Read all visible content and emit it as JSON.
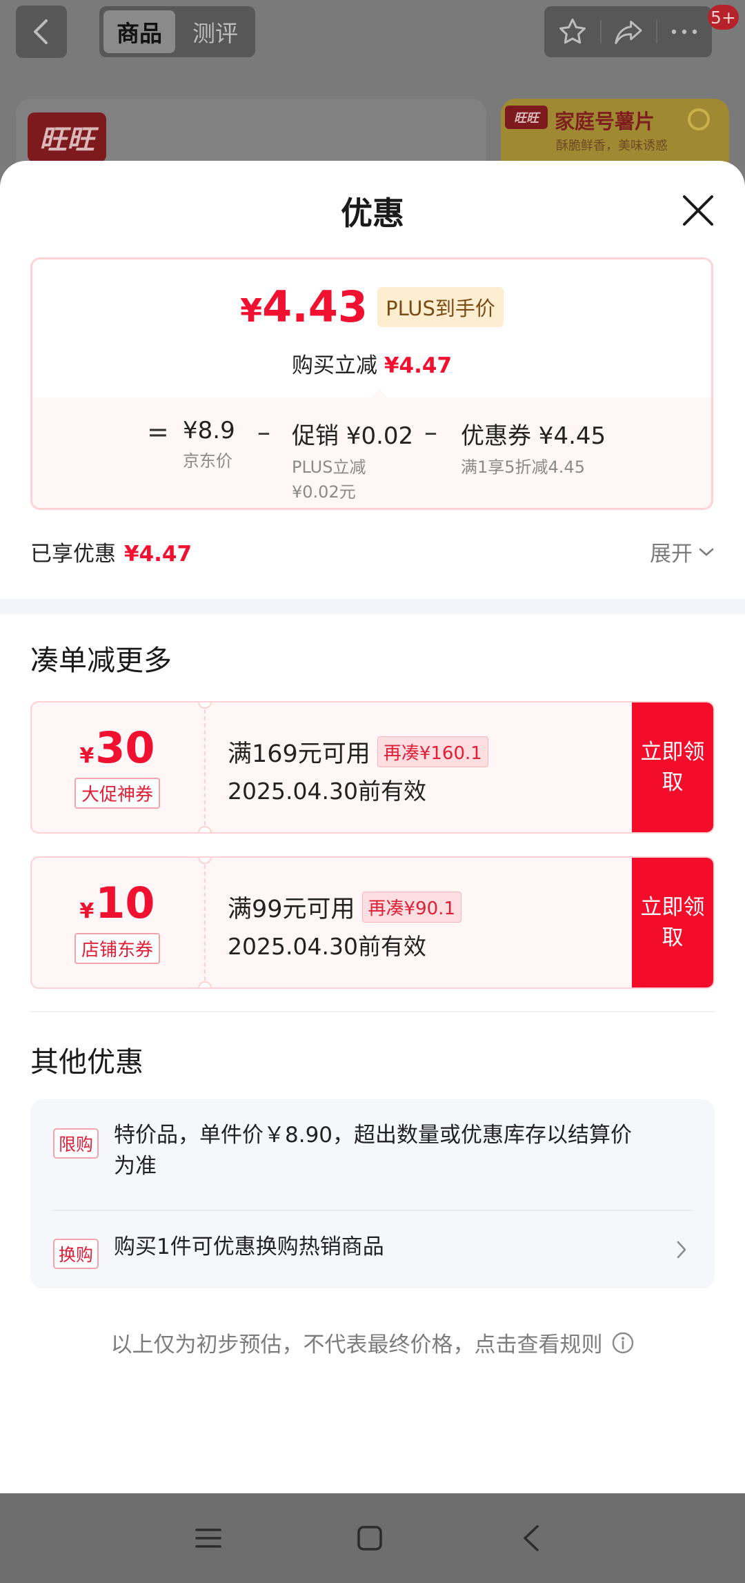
{
  "header": {
    "tabs": [
      {
        "label": "商品",
        "active": true
      },
      {
        "label": "测评",
        "active": false
      }
    ],
    "icons": [
      "back-icon",
      "star-icon",
      "share-icon",
      "more-icon"
    ],
    "message_badge": "5+"
  },
  "background": {
    "brand_logo": "旺旺",
    "ad_logo": "旺旺",
    "ad_title": "家庭号薯片",
    "ad_subtitle": "酥脆鲜香，美味诱惑"
  },
  "sheet": {
    "title": "优惠",
    "price": {
      "final_yen": "¥",
      "final_value": "4.43",
      "plus_label": "PLUS到手价",
      "reduce_label": "购买立减",
      "reduce_amount": "¥4.47"
    },
    "breakdown": {
      "eq": "=",
      "minus": "–",
      "items": [
        {
          "main": "¥8.9",
          "sub": "京东价"
        },
        {
          "main": "促销 ¥0.02",
          "sub": "PLUS立减 ¥0.02元"
        },
        {
          "main": "优惠券 ¥4.45",
          "sub": "满1享5折减4.45"
        }
      ]
    },
    "saved": {
      "label": "已享优惠",
      "amount": "¥4.47"
    },
    "expand_label": "展开",
    "coupon_section_title": "凑单减更多",
    "coupons": [
      {
        "yen": "¥",
        "amount": "30",
        "tag": "大促神券",
        "condition": "满169元可用",
        "extra": "再凑¥160.1",
        "validity": "2025.04.30前有效",
        "claim": "立即领取"
      },
      {
        "yen": "¥",
        "amount": "10",
        "tag": "店铺东券",
        "condition": "满99元可用",
        "extra": "再凑¥90.1",
        "validity": "2025.04.30前有效",
        "claim": "立即领取"
      }
    ],
    "other_section_title": "其他优惠",
    "other_offers": [
      {
        "tag": "限购",
        "text": "特价品，单件价￥8.90，超出数量或优惠库存以结算价为准"
      },
      {
        "tag": "换购",
        "text": "购买1件可优惠换购热销商品"
      }
    ],
    "disclaimer": "以上仅为初步预估，不代表最终价格，点击查看规则"
  },
  "colors": {
    "accent": "#f40d2b",
    "plus_badge_bg": "#fdeed1",
    "sheet_bg": "#ffffff"
  }
}
